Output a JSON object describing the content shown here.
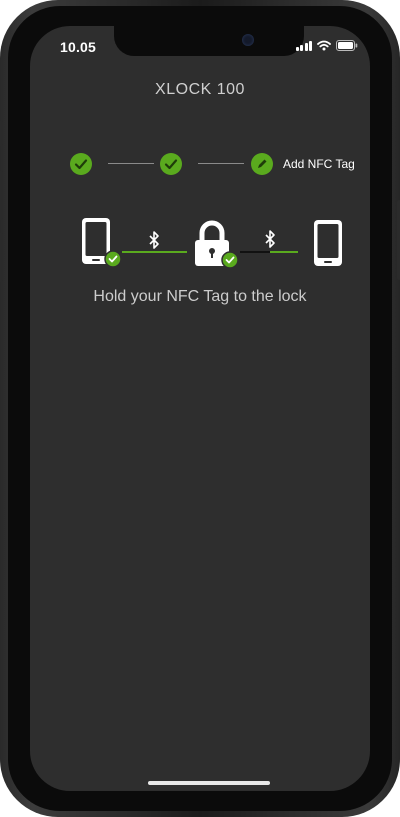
{
  "status_bar": {
    "time": "10.05"
  },
  "app": {
    "title": "XLOCK 100"
  },
  "steps": [
    {
      "state": "done",
      "icon": "check-icon"
    },
    {
      "state": "done",
      "icon": "check-icon"
    },
    {
      "state": "current",
      "icon": "pencil-icon",
      "label": "Add NFC Tag"
    }
  ],
  "diagram": {
    "left_device": "phone-icon",
    "left_link": "bluetooth-icon",
    "center": "lock-icon",
    "right_link": "bluetooth-icon",
    "right_device": "phone-icon"
  },
  "message": "Hold your NFC Tag to the lock",
  "colors": {
    "screen_bg": "#2e2e2e",
    "accent_green": "#5aaa1e",
    "text": "#cccccc"
  }
}
